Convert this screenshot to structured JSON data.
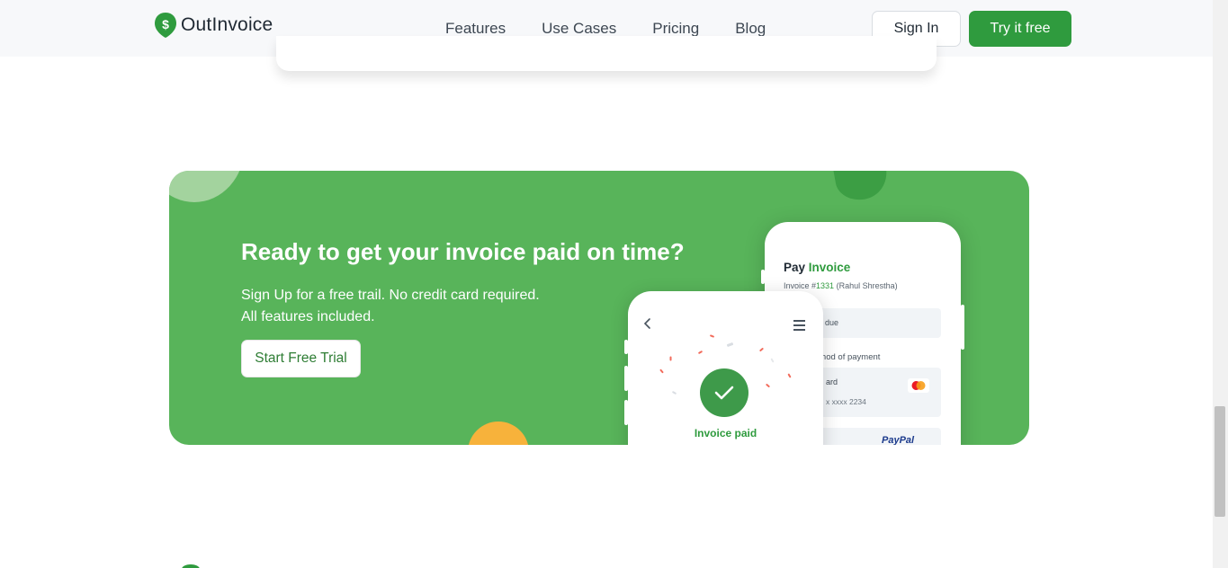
{
  "header": {
    "brand": "OutInvoice",
    "nav": [
      {
        "label": "Features"
      },
      {
        "label": "Use Cases"
      },
      {
        "label": "Pricing"
      },
      {
        "label": "Blog"
      }
    ],
    "signin_label": "Sign In",
    "try_label": "Try it free"
  },
  "cta": {
    "title": "Ready to get your invoice paid on time?",
    "subtitle_line1": "Sign Up for a free trail. No credit card required.",
    "subtitle_line2": "All features included.",
    "button_label": "Start Free Trial"
  },
  "phone_back": {
    "title_pay": "Pay",
    "title_invoice": "Invoice",
    "invoice_prefix": "Invoice #",
    "invoice_number": "1331",
    "invoice_client": "(Rahul Shrestha)",
    "due_label": "due",
    "method_label": "ethod of payment",
    "card_label": "ard",
    "card_number": "x xxxx 2234",
    "paypal_label": "PayPal"
  },
  "phone_front": {
    "status": "Invoice paid"
  },
  "colors": {
    "brand_green": "#2f9b3e",
    "banner_green": "#58b45a",
    "accent_orange": "#f7b23b"
  },
  "icons": [
    "dollar-logo-icon",
    "chevron-left-icon",
    "hamburger-menu-icon",
    "check-icon",
    "mastercard-icon"
  ]
}
